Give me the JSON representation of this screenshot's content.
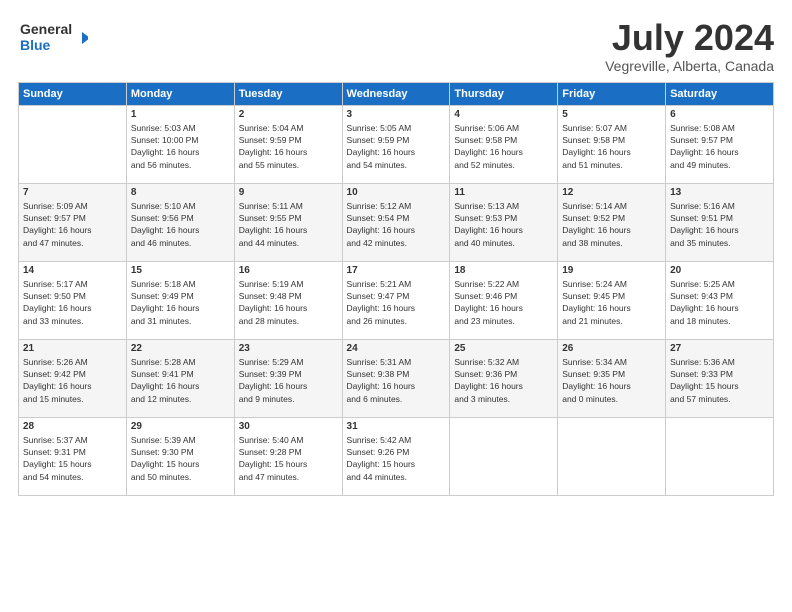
{
  "header": {
    "logo_line1": "General",
    "logo_line2": "Blue",
    "title": "July 2024",
    "subtitle": "Vegreville, Alberta, Canada"
  },
  "days_of_week": [
    "Sunday",
    "Monday",
    "Tuesday",
    "Wednesday",
    "Thursday",
    "Friday",
    "Saturday"
  ],
  "weeks": [
    [
      {
        "day": "",
        "info": ""
      },
      {
        "day": "1",
        "info": "Sunrise: 5:03 AM\nSunset: 10:00 PM\nDaylight: 16 hours\nand 56 minutes."
      },
      {
        "day": "2",
        "info": "Sunrise: 5:04 AM\nSunset: 9:59 PM\nDaylight: 16 hours\nand 55 minutes."
      },
      {
        "day": "3",
        "info": "Sunrise: 5:05 AM\nSunset: 9:59 PM\nDaylight: 16 hours\nand 54 minutes."
      },
      {
        "day": "4",
        "info": "Sunrise: 5:06 AM\nSunset: 9:58 PM\nDaylight: 16 hours\nand 52 minutes."
      },
      {
        "day": "5",
        "info": "Sunrise: 5:07 AM\nSunset: 9:58 PM\nDaylight: 16 hours\nand 51 minutes."
      },
      {
        "day": "6",
        "info": "Sunrise: 5:08 AM\nSunset: 9:57 PM\nDaylight: 16 hours\nand 49 minutes."
      }
    ],
    [
      {
        "day": "7",
        "info": "Sunrise: 5:09 AM\nSunset: 9:57 PM\nDaylight: 16 hours\nand 47 minutes."
      },
      {
        "day": "8",
        "info": "Sunrise: 5:10 AM\nSunset: 9:56 PM\nDaylight: 16 hours\nand 46 minutes."
      },
      {
        "day": "9",
        "info": "Sunrise: 5:11 AM\nSunset: 9:55 PM\nDaylight: 16 hours\nand 44 minutes."
      },
      {
        "day": "10",
        "info": "Sunrise: 5:12 AM\nSunset: 9:54 PM\nDaylight: 16 hours\nand 42 minutes."
      },
      {
        "day": "11",
        "info": "Sunrise: 5:13 AM\nSunset: 9:53 PM\nDaylight: 16 hours\nand 40 minutes."
      },
      {
        "day": "12",
        "info": "Sunrise: 5:14 AM\nSunset: 9:52 PM\nDaylight: 16 hours\nand 38 minutes."
      },
      {
        "day": "13",
        "info": "Sunrise: 5:16 AM\nSunset: 9:51 PM\nDaylight: 16 hours\nand 35 minutes."
      }
    ],
    [
      {
        "day": "14",
        "info": "Sunrise: 5:17 AM\nSunset: 9:50 PM\nDaylight: 16 hours\nand 33 minutes."
      },
      {
        "day": "15",
        "info": "Sunrise: 5:18 AM\nSunset: 9:49 PM\nDaylight: 16 hours\nand 31 minutes."
      },
      {
        "day": "16",
        "info": "Sunrise: 5:19 AM\nSunset: 9:48 PM\nDaylight: 16 hours\nand 28 minutes."
      },
      {
        "day": "17",
        "info": "Sunrise: 5:21 AM\nSunset: 9:47 PM\nDaylight: 16 hours\nand 26 minutes."
      },
      {
        "day": "18",
        "info": "Sunrise: 5:22 AM\nSunset: 9:46 PM\nDaylight: 16 hours\nand 23 minutes."
      },
      {
        "day": "19",
        "info": "Sunrise: 5:24 AM\nSunset: 9:45 PM\nDaylight: 16 hours\nand 21 minutes."
      },
      {
        "day": "20",
        "info": "Sunrise: 5:25 AM\nSunset: 9:43 PM\nDaylight: 16 hours\nand 18 minutes."
      }
    ],
    [
      {
        "day": "21",
        "info": "Sunrise: 5:26 AM\nSunset: 9:42 PM\nDaylight: 16 hours\nand 15 minutes."
      },
      {
        "day": "22",
        "info": "Sunrise: 5:28 AM\nSunset: 9:41 PM\nDaylight: 16 hours\nand 12 minutes."
      },
      {
        "day": "23",
        "info": "Sunrise: 5:29 AM\nSunset: 9:39 PM\nDaylight: 16 hours\nand 9 minutes."
      },
      {
        "day": "24",
        "info": "Sunrise: 5:31 AM\nSunset: 9:38 PM\nDaylight: 16 hours\nand 6 minutes."
      },
      {
        "day": "25",
        "info": "Sunrise: 5:32 AM\nSunset: 9:36 PM\nDaylight: 16 hours\nand 3 minutes."
      },
      {
        "day": "26",
        "info": "Sunrise: 5:34 AM\nSunset: 9:35 PM\nDaylight: 16 hours\nand 0 minutes."
      },
      {
        "day": "27",
        "info": "Sunrise: 5:36 AM\nSunset: 9:33 PM\nDaylight: 15 hours\nand 57 minutes."
      }
    ],
    [
      {
        "day": "28",
        "info": "Sunrise: 5:37 AM\nSunset: 9:31 PM\nDaylight: 15 hours\nand 54 minutes."
      },
      {
        "day": "29",
        "info": "Sunrise: 5:39 AM\nSunset: 9:30 PM\nDaylight: 15 hours\nand 50 minutes."
      },
      {
        "day": "30",
        "info": "Sunrise: 5:40 AM\nSunset: 9:28 PM\nDaylight: 15 hours\nand 47 minutes."
      },
      {
        "day": "31",
        "info": "Sunrise: 5:42 AM\nSunset: 9:26 PM\nDaylight: 15 hours\nand 44 minutes."
      },
      {
        "day": "",
        "info": ""
      },
      {
        "day": "",
        "info": ""
      },
      {
        "day": "",
        "info": ""
      }
    ]
  ]
}
